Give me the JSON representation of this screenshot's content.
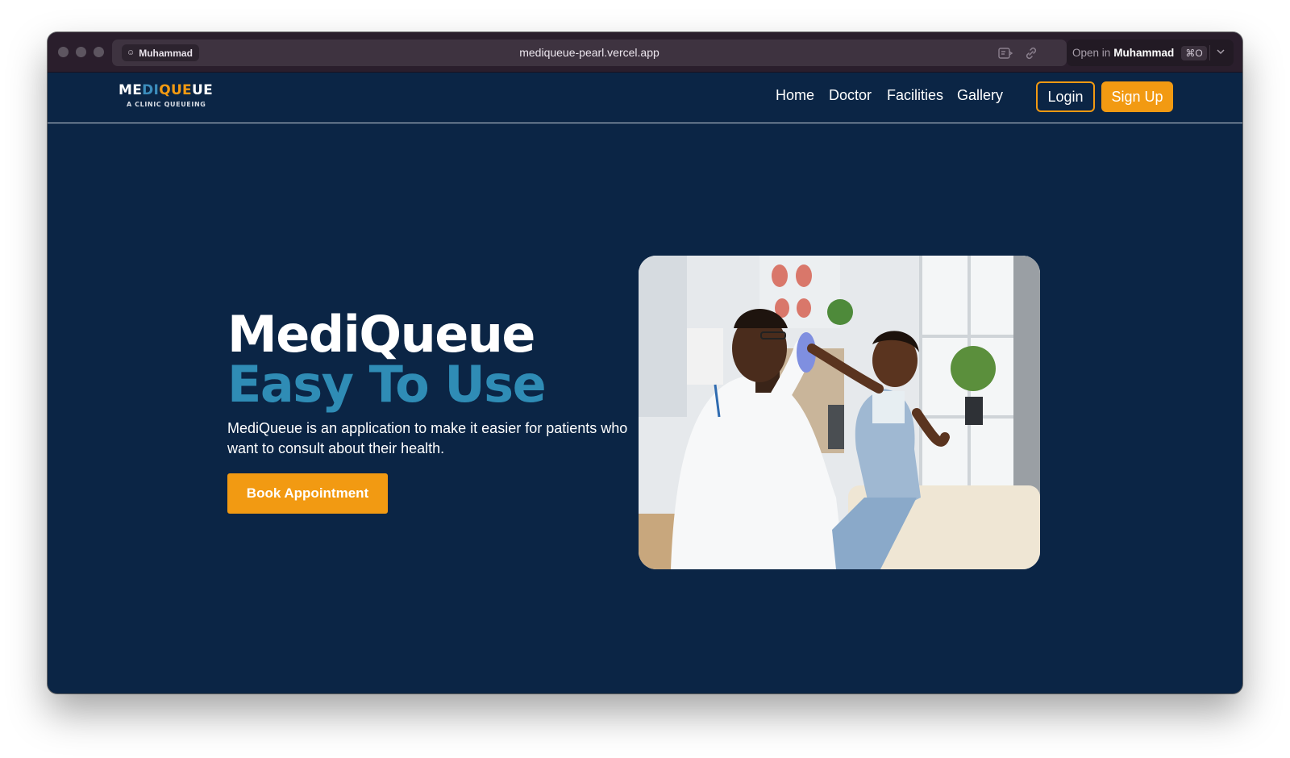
{
  "browser": {
    "profile_name": "Muhammad",
    "url": "mediqueue-pearl.vercel.app",
    "open_in_prefix": "Open in",
    "open_in_profile": "Muhammad",
    "shortcut": "⌘O"
  },
  "brand": {
    "logo_parts": [
      "ME",
      "DI",
      "QUE",
      "UE"
    ],
    "tagline": "A CLINIC QUEUEING"
  },
  "nav": {
    "items": [
      "Home",
      "Doctor",
      "Facilities",
      "Gallery"
    ],
    "login_label": "Login",
    "signup_label": "Sign Up"
  },
  "hero": {
    "title": "MediQueue",
    "subtitle": "Easy To Use",
    "description": "MediQueue is an application to make it easier for patients who want to consult about their health.",
    "cta_label": "Book Appointment"
  },
  "colors": {
    "background": "#0b2545",
    "accent_orange": "#f29a12",
    "accent_blue": "#2f8cb5",
    "titlebar": "#2a1e2c"
  },
  "icons": {
    "profile": "smiley-icon",
    "reader": "reader-mode-icon",
    "link": "link-icon",
    "chevron": "chevron-down-icon"
  }
}
